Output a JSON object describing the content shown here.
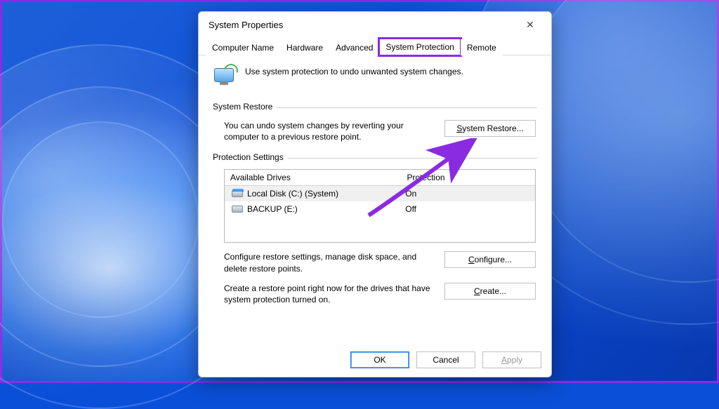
{
  "window": {
    "title": "System Properties",
    "close_glyph": "✕"
  },
  "tabs": {
    "computer_name": "Computer Name",
    "hardware": "Hardware",
    "advanced": "Advanced",
    "system_protection": "System Protection",
    "remote": "Remote"
  },
  "intro": "Use system protection to undo unwanted system changes.",
  "restore": {
    "group_label": "System Restore",
    "desc": "You can undo system changes by reverting your computer to a previous restore point.",
    "button_prefix": "S",
    "button_rest": "ystem Restore..."
  },
  "protection": {
    "group_label": "Protection Settings",
    "col_drive": "Available Drives",
    "col_protection": "Protection",
    "drives": [
      {
        "name": "Local Disk (C:) (System)",
        "protection": "On",
        "selected": true,
        "iconBlue": true
      },
      {
        "name": "BACKUP (E:)",
        "protection": "Off",
        "selected": false,
        "iconBlue": false
      }
    ],
    "configure_desc": "Configure restore settings, manage disk space, and delete restore points.",
    "configure_prefix": "C",
    "configure_rest": "onfigure...",
    "create_desc": "Create a restore point right now for the drives that have system protection turned on.",
    "create_prefix": "C",
    "create_rest": "reate..."
  },
  "footer": {
    "ok": "OK",
    "cancel": "Cancel",
    "apply_prefix": "A",
    "apply_rest": "pply"
  },
  "annotation": {
    "highlight_color": "#8a2be2"
  }
}
